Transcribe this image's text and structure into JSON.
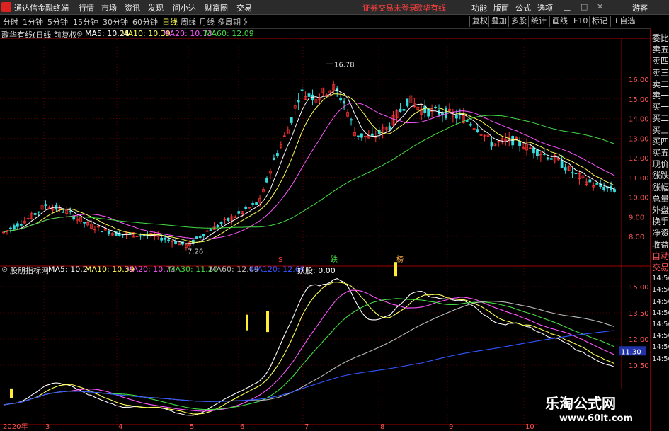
{
  "app": {
    "title": "通达信金融终端"
  },
  "menu": [
    "行情",
    "市场",
    "资讯",
    "发现",
    "问小达",
    "财富圈",
    "交易"
  ],
  "alert": {
    "login": "证券交易未登录",
    "stock": "歌华有线"
  },
  "top_right": [
    "功能",
    "版面",
    "公式",
    "选项",
    "游客"
  ],
  "periods": [
    {
      "label": "分时"
    },
    {
      "label": "1分钟"
    },
    {
      "label": "5分钟"
    },
    {
      "label": "15分钟"
    },
    {
      "label": "30分钟"
    },
    {
      "label": "60分钟"
    },
    {
      "label": "日线",
      "active": true
    },
    {
      "label": "周线"
    },
    {
      "label": "月线"
    },
    {
      "label": "多周期"
    }
  ],
  "period_more": "》",
  "tool_buttons": [
    "复权",
    "叠加",
    "多股",
    "统计",
    "画线",
    "F10",
    "标记",
    "+自选"
  ],
  "main": {
    "title": "歌华有线(日线 前复权)",
    "ma": [
      {
        "label": "MA5: 10.24",
        "color": "#ffffff"
      },
      {
        "label": "MA10: 10.39",
        "color": "#ffff55"
      },
      {
        "label": "MA20: 10.73",
        "color": "#ff55ff"
      },
      {
        "label": "MA60: 12.09",
        "color": "#44dd44"
      }
    ],
    "yticks": [
      "16.00",
      "15.00",
      "14.00",
      "13.00",
      "12.00",
      "11.00",
      "10.00",
      "9.00",
      "8.00"
    ],
    "high_label": "16.78",
    "low_label": "7.26",
    "markers": [
      {
        "text": "S",
        "color": "#ff4040"
      },
      {
        "text": "跌",
        "color": "#44dd44"
      },
      {
        "text": "榜",
        "color": "#ffaa44"
      }
    ]
  },
  "sub": {
    "title": "股朋指标网",
    "ma": [
      {
        "label": "MA5: 10.24",
        "color": "#ffffff"
      },
      {
        "label": "MA10: 10.39",
        "color": "#ffff55"
      },
      {
        "label": "MA20: 10.73",
        "color": "#ff55ff"
      },
      {
        "label": "MA30: 11.20",
        "color": "#44dd44"
      },
      {
        "label": "MA60: 12.09",
        "color": "#bbbbbb"
      },
      {
        "label": "MA120: 12.69",
        "color": "#3355ff"
      },
      {
        "label": "妖股: 0.00",
        "color": "#ffffff"
      }
    ],
    "yticks": [
      "15.00",
      "13.50",
      "12.00",
      "10.50"
    ],
    "price_tag": "11.30"
  },
  "xaxis": [
    "2020年",
    "3",
    "4",
    "5",
    "6",
    "7",
    "8",
    "9",
    "10"
  ],
  "right_panel": [
    "委比",
    "卖五",
    "卖四",
    "卖三",
    "卖二",
    "卖一",
    "买一",
    "买二",
    "买三",
    "买四",
    "买五",
    "现价",
    "涨跌",
    "涨幅",
    "总量",
    "外盘",
    "换手",
    "净资",
    "收益",
    "自动",
    "交易",
    "14:56",
    "14:56",
    "14:56",
    "14:56",
    "14:56",
    "14:56",
    "14:56",
    "14:56"
  ],
  "watermark": {
    "line1": "乐淘公式网",
    "line2": "www.60lt.com"
  },
  "colors": {
    "up": "#ff3333",
    "down": "#33dddd",
    "grid": "#a00000"
  }
}
